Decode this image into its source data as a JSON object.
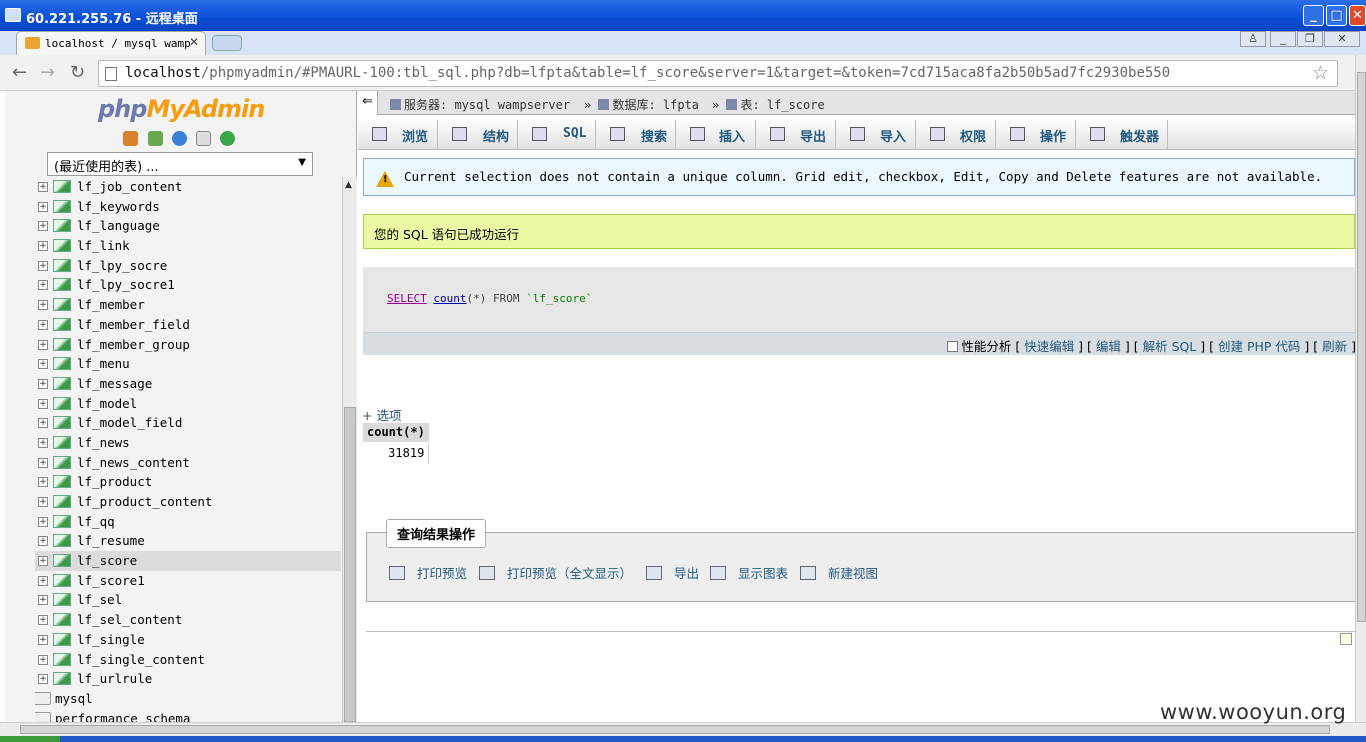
{
  "window": {
    "title": "60.221.255.76 - 远程桌面"
  },
  "browser": {
    "tab_title": "localhost / mysql wamp",
    "url_host": "localhost",
    "url_rest": "/phpmyadmin/#PMAURL-100:tbl_sql.php?db=lfpta&table=lf_score&server=1&target=&token=7cd715aca8fa2b50b5ad7fc2930be550"
  },
  "sidebar": {
    "logo_php": "php",
    "logo_myadmin": "MyAdmin",
    "recent_label": "(最近使用的表) ...",
    "tables": [
      {
        "name": "lf_job_content"
      },
      {
        "name": "lf_keywords"
      },
      {
        "name": "lf_language"
      },
      {
        "name": "lf_link"
      },
      {
        "name": "lf_lpy_socre"
      },
      {
        "name": "lf_lpy_socre1"
      },
      {
        "name": "lf_member"
      },
      {
        "name": "lf_member_field"
      },
      {
        "name": "lf_member_group"
      },
      {
        "name": "lf_menu"
      },
      {
        "name": "lf_message"
      },
      {
        "name": "lf_model"
      },
      {
        "name": "lf_model_field"
      },
      {
        "name": "lf_news"
      },
      {
        "name": "lf_news_content"
      },
      {
        "name": "lf_product"
      },
      {
        "name": "lf_product_content"
      },
      {
        "name": "lf_qq"
      },
      {
        "name": "lf_resume"
      },
      {
        "name": "lf_score"
      },
      {
        "name": "lf_score1"
      },
      {
        "name": "lf_sel"
      },
      {
        "name": "lf_sel_content"
      },
      {
        "name": "lf_single"
      },
      {
        "name": "lf_single_content"
      },
      {
        "name": "lf_urlrule"
      }
    ],
    "selected_table": "lf_score",
    "databases": [
      {
        "name": "mysql"
      },
      {
        "name": "performance_schema"
      }
    ]
  },
  "breadcrumb": {
    "server_label": "服务器: mysql wampserver",
    "db_label": "数据库: lfpta",
    "table_label": "表: lf_score"
  },
  "menu": {
    "browse": "浏览",
    "structure": "结构",
    "sql": "SQL",
    "search": "搜索",
    "insert": "插入",
    "export": "导出",
    "import": "导入",
    "privileges": "权限",
    "operations": "操作",
    "triggers": "触发器"
  },
  "notice": "Current selection does not contain a unique column. Grid edit, checkbox, Edit, Copy and Delete features are not available.",
  "success": "您的 SQL 语句已成功运行",
  "sql": {
    "select": "SELECT",
    "count": "count",
    "rest": "(*) FROM",
    "table": "`lf_score`"
  },
  "sql_actions": {
    "profiling": "性能分析",
    "inline_edit": "快速编辑",
    "edit": "编辑",
    "explain": "解析 SQL",
    "create_php": "创建 PHP 代码",
    "refresh": "刷新"
  },
  "options_label": "+ 选项",
  "result": {
    "column": "count(*)",
    "value": "31819"
  },
  "query_ops": {
    "legend": "查询结果操作",
    "print": "打印预览",
    "print_full": "打印预览（全文显示）",
    "export": "导出",
    "chart": "显示图表",
    "view": "新建视图"
  },
  "watermark": "www.wooyun.org"
}
